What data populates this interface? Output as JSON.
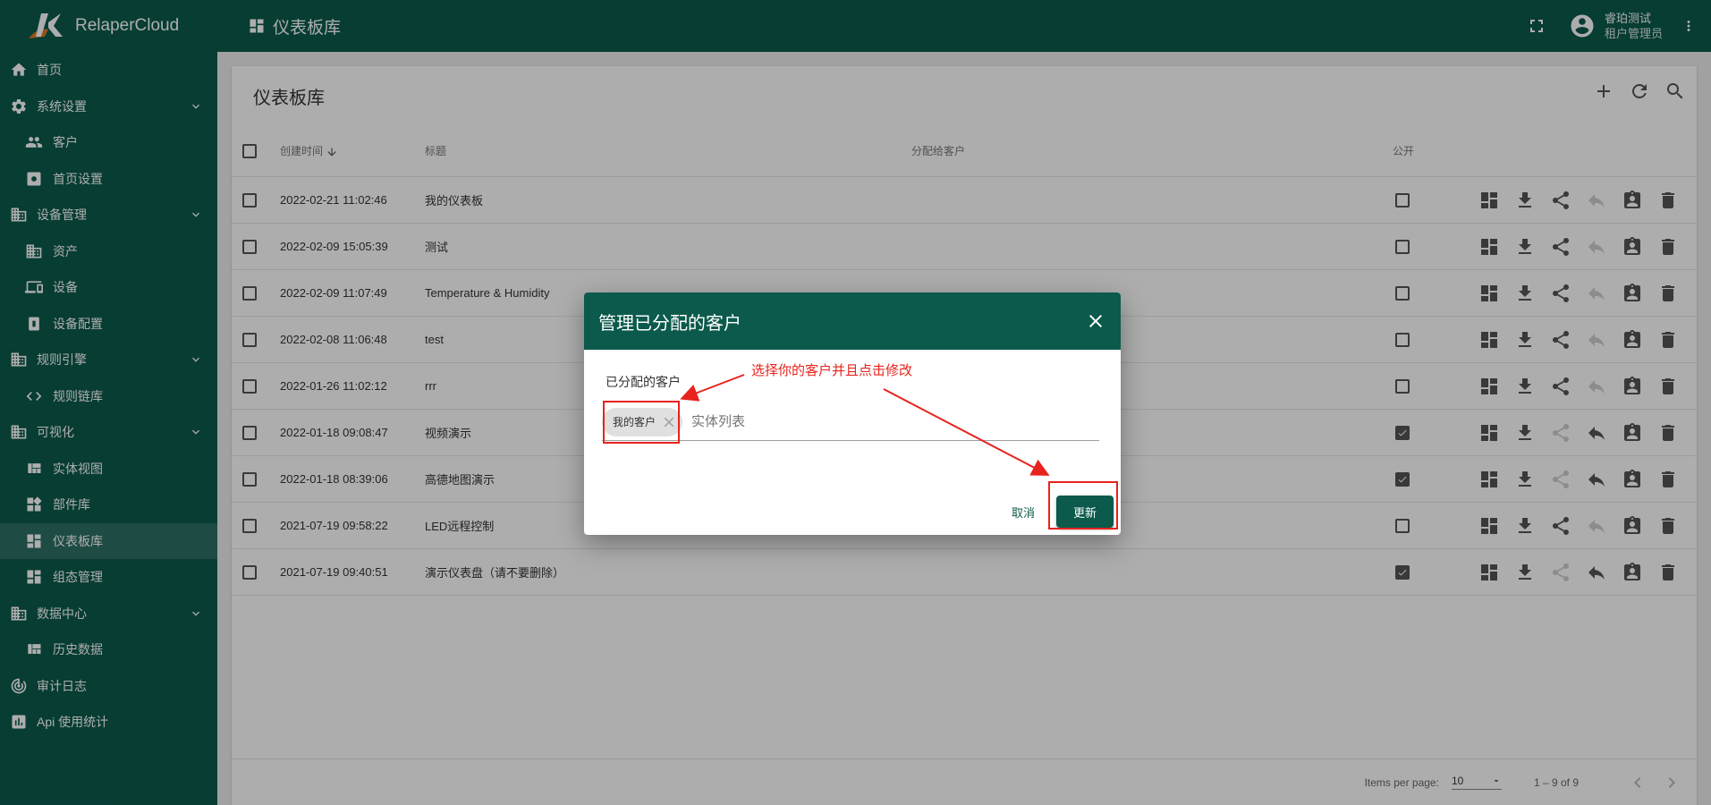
{
  "brand": {
    "name": "RelaperCloud"
  },
  "topbar": {
    "title": "仪表板库",
    "user_name": "睿珀测试",
    "user_role": "租户管理员"
  },
  "sidebar": {
    "items": [
      {
        "label": "首页",
        "icon": "home-icon",
        "level": "top"
      },
      {
        "label": "系统设置",
        "icon": "gear-icon",
        "level": "top",
        "expandable": true
      },
      {
        "label": "客户",
        "icon": "people-icon",
        "level": "sub"
      },
      {
        "label": "首页设置",
        "icon": "settings-box-icon",
        "level": "sub"
      },
      {
        "label": "设备管理",
        "icon": "building-icon",
        "level": "top",
        "expandable": true
      },
      {
        "label": "资产",
        "icon": "building-icon",
        "level": "sub"
      },
      {
        "label": "设备",
        "icon": "devices-icon",
        "level": "sub"
      },
      {
        "label": "设备配置",
        "icon": "device-profile-icon",
        "level": "sub"
      },
      {
        "label": "规则引擎",
        "icon": "building-icon",
        "level": "top",
        "expandable": true
      },
      {
        "label": "规则链库",
        "icon": "code-icon",
        "level": "sub"
      },
      {
        "label": "可视化",
        "icon": "building-icon",
        "level": "top",
        "expandable": true
      },
      {
        "label": "实体视图",
        "icon": "view-quilt-icon",
        "level": "sub"
      },
      {
        "label": "部件库",
        "icon": "widgets-icon",
        "level": "sub"
      },
      {
        "label": "仪表板库",
        "icon": "dashboard-icon",
        "level": "sub",
        "active": true
      },
      {
        "label": "组态管理",
        "icon": "dashboard-icon",
        "level": "sub"
      },
      {
        "label": "数据中心",
        "icon": "building-icon",
        "level": "top",
        "expandable": true
      },
      {
        "label": "历史数据",
        "icon": "view-quilt-icon",
        "level": "sub"
      },
      {
        "label": "审计日志",
        "icon": "track-changes-icon",
        "level": "top"
      },
      {
        "label": "Api 使用统计",
        "icon": "bar-chart-icon",
        "level": "top"
      }
    ]
  },
  "card": {
    "title": "仪表板库"
  },
  "table": {
    "headers": {
      "created": "创建时间",
      "title": "标题",
      "customers": "分配给客户",
      "public": "公开"
    },
    "rows": [
      {
        "created": "2022-02-21 11:02:46",
        "title": "我的仪表板",
        "public": false
      },
      {
        "created": "2022-02-09 15:05:39",
        "title": "测试",
        "public": false
      },
      {
        "created": "2022-02-09 11:07:49",
        "title": "Temperature & Humidity",
        "public": false
      },
      {
        "created": "2022-02-08 11:06:48",
        "title": "test",
        "public": false
      },
      {
        "created": "2022-01-26 11:02:12",
        "title": "rrr",
        "public": false
      },
      {
        "created": "2022-01-18 09:08:47",
        "title": "视频演示",
        "public": true
      },
      {
        "created": "2022-01-18 08:39:06",
        "title": "高德地图演示",
        "public": true
      },
      {
        "created": "2021-07-19 09:58:22",
        "title": "LED远程控制",
        "public": false
      },
      {
        "created": "2021-07-19 09:40:51",
        "title": "演示仪表盘（请不要删除）",
        "public": true
      }
    ]
  },
  "paginator": {
    "items_per_page_label": "Items per page:",
    "items_per_page": "10",
    "range": "1 – 9 of 9"
  },
  "dialog": {
    "title": "管理已分配的客户",
    "field_label": "已分配的客户",
    "chip": "我的客户",
    "input_placeholder": "实体列表",
    "cancel": "取消",
    "update": "更新"
  },
  "annotation": {
    "text": "选择你的客户并且点击修改"
  },
  "colors": {
    "primary": "#0b5a4c",
    "annotation": "#e8231e"
  }
}
